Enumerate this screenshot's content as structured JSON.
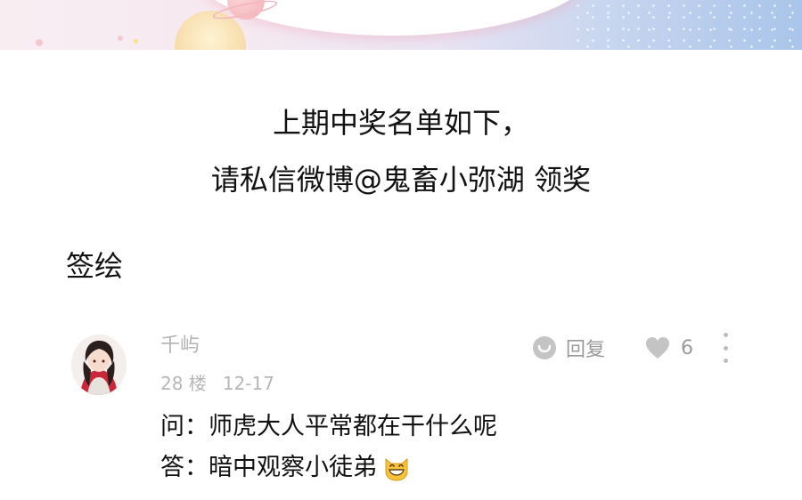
{
  "announcement": {
    "line1": "上期中奖名单如下，",
    "line2": "请私信微博@鬼畜小弥湖 领奖"
  },
  "section": {
    "title": "签绘"
  },
  "comment": {
    "username": "千屿",
    "floor": "28 楼",
    "date": "12-17",
    "reply_label": "回复",
    "like_count": "6",
    "question": "问：师虎大人平常都在干什么呢",
    "answer": "答：暗中观察小徒弟",
    "emoji": "grinning-cat-emoji"
  },
  "icons": {
    "reply": "reply-bubble-icon",
    "like": "heart-icon",
    "more": "more-vertical-icon"
  },
  "colors": {
    "meta_gray": "#b7b7b7",
    "action_gray": "#9a9a9a",
    "text": "#111111"
  }
}
